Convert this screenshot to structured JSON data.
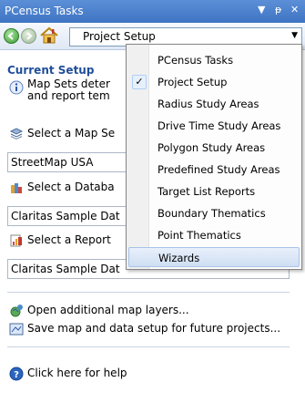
{
  "window": {
    "title": "PCensus Tasks",
    "menu_glyph": "▼",
    "pin_glyph": "ᵽ",
    "close_glyph": "✕"
  },
  "toolbar": {
    "back_icon": "back-arrow-icon",
    "forward_icon": "forward-arrow-icon",
    "home_icon": "home-icon",
    "combo_value": "Project Setup"
  },
  "main": {
    "heading": "Current Setup",
    "info_line1": "Map Sets deter",
    "info_line2": "and report tem",
    "map_set_label": "Select a Map Se",
    "map_set_value": "StreetMap USA",
    "database_label": "Select a Databa",
    "database_value": "Claritas Sample Dat",
    "report_label": "Select a Report",
    "report_value": "Claritas Sample Dat",
    "open_layers": "Open additional map layers...",
    "save_setup": "Save map and data setup for future projects...",
    "help": "Click here for help"
  },
  "dropdown": {
    "items": [
      {
        "label": "PCensus Tasks"
      },
      {
        "label": "Project Setup"
      },
      {
        "label": "Radius Study Areas"
      },
      {
        "label": "Drive Time Study Areas"
      },
      {
        "label": "Polygon Study Areas"
      },
      {
        "label": "Predefined Study Areas"
      },
      {
        "label": "Target List Reports"
      },
      {
        "label": "Boundary Thematics"
      },
      {
        "label": "Point Thematics"
      },
      {
        "label": "Wizards"
      }
    ],
    "checked_item": "Project Setup",
    "hovered_item": "Wizards",
    "check_glyph": "✓"
  },
  "colors": {
    "title_bar": "#4a80cf",
    "heading": "#1f4e9a",
    "hover": "#cfdef3"
  }
}
